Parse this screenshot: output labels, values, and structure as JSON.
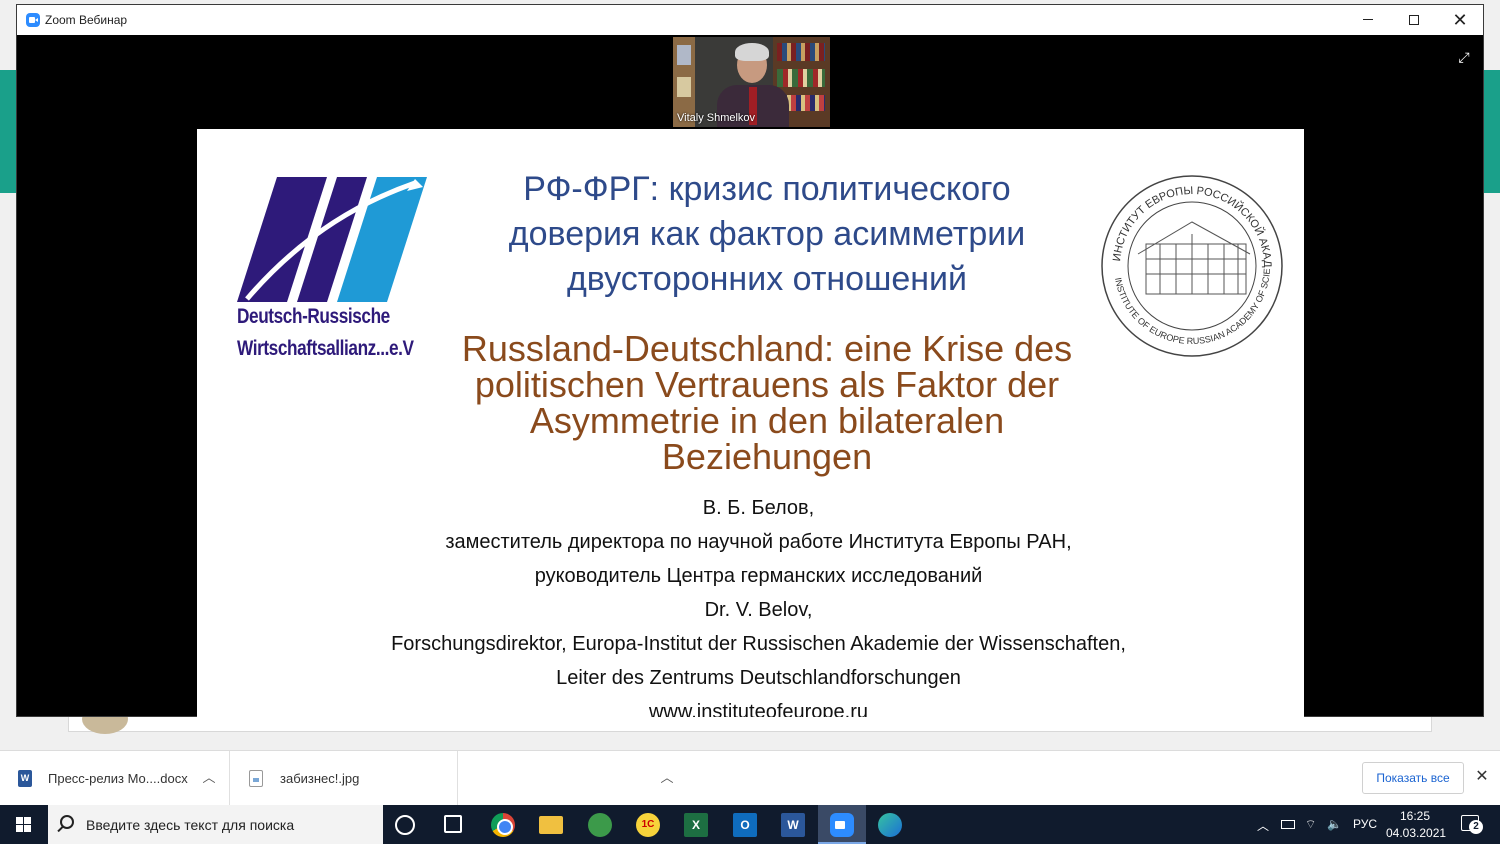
{
  "window": {
    "title": "Zoom Вебинар",
    "minimize_icon": "minimize-icon",
    "maximize_icon": "maximize-icon",
    "close_icon": "close-icon"
  },
  "speaker": {
    "name": "Vitaly Shmelkov"
  },
  "slide": {
    "logo_left_line1": "Deutsch-Russische",
    "logo_left_line2": "Wirtschaftsallianz...e.V",
    "title_ru": "РФ-ФРГ: кризис политического доверия как фактор асимметрии двусторонних отношений",
    "title_de": "Russland-Deutschland: eine Krise des politischen Vertrauens als Faktor der Asymmetrie in den bilateralen Beziehungen",
    "seal_top_text": "ИНСТИТУТ ЕВРОПЫ РОССИЙСКОЙ АКАДЕМИИ НАУК",
    "seal_bottom_text": "INSTITUTE OF EUROPE RUSSIAN ACADEMY OF SCIENCES",
    "author_ru": "В. Б. Белов,",
    "position_ru": "заместитель директора по научной работе Института Европы РАН,",
    "center_ru": "руководитель Центра германских исследований",
    "author_de": "Dr. V. Belov,",
    "position_de": "Forschungsdirektor, Europa-Institut der Russischen Akademie der Wissenschaften,",
    "center_de": "Leiter des Zentrums Deutschlandforschungen",
    "website": "www.instituteofeurope.ru"
  },
  "downloads": {
    "items": [
      {
        "name": "Пресс-релиз Мо....docx",
        "icon": "word-file-icon"
      },
      {
        "name": "забизнес!.jpg",
        "icon": "image-file-icon"
      }
    ],
    "show_all": "Показать все"
  },
  "taskbar": {
    "search_placeholder": "Введите здесь текст для поиска",
    "language": "РУС",
    "time": "16:25",
    "date": "04.03.2021",
    "notifications": "2",
    "colors": {
      "taskbar_bg": "#101b2d",
      "zoom_blue": "#2d8cff"
    }
  }
}
